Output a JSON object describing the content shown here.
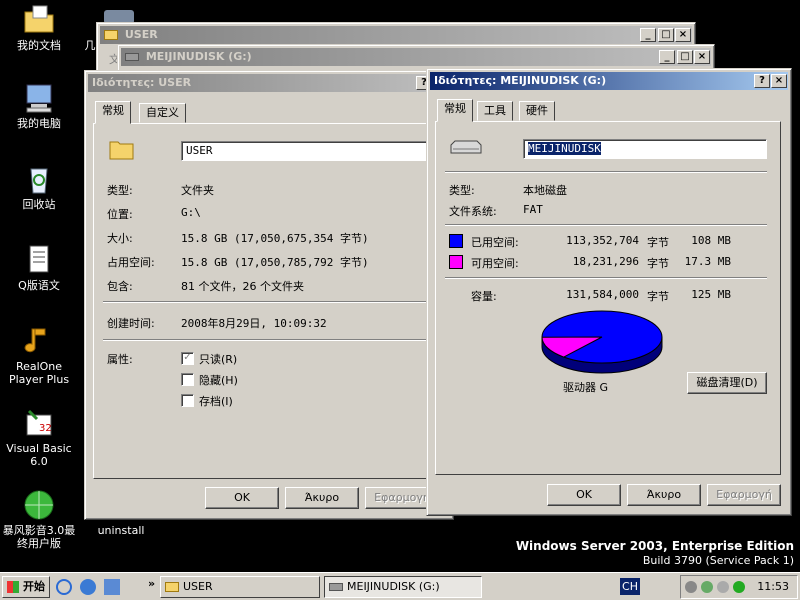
{
  "desktop": {
    "icons": [
      {
        "label": "我的文档"
      },
      {
        "label": "我的电脑"
      },
      {
        "label": "回收站"
      },
      {
        "label": "Q版语文"
      },
      {
        "label": "RealOne Player Plus"
      },
      {
        "label": "Visual Basic 6.0"
      },
      {
        "label": "暴风影音3.0最终用户版"
      },
      {
        "label": "uninstall"
      },
      {
        "label": "几"
      }
    ],
    "os_line1": "Windows Server 2003, Enterprise Edition",
    "os_line2": "Build 3790 (Service Pack 1)"
  },
  "bg_windows": {
    "user_title": "USER",
    "meiji_title": "MEIJINUDISK (G:)",
    "partial_text": "文"
  },
  "user_props": {
    "title": "Ιδιότητες: USER",
    "tabs": [
      "常规",
      "自定义"
    ],
    "name_value": "USER",
    "rows": [
      {
        "label": "类型:",
        "value": "文件夹"
      },
      {
        "label": "位置:",
        "value": "G:\\"
      },
      {
        "label": "大小:",
        "value": "15.8 GB (17,050,675,354 字节)"
      },
      {
        "label": "占用空间:",
        "value": "15.8 GB (17,050,785,792 字节)"
      },
      {
        "label": "包含:",
        "value": "81 个文件，26 个文件夹"
      }
    ],
    "created_label": "创建时间:",
    "created_value": "2008年8月29日, 10:09:32",
    "attr_label": "属性:",
    "attrs": [
      {
        "label": "只读(R)",
        "checked": true
      },
      {
        "label": "隐藏(H)",
        "checked": false
      },
      {
        "label": "存档(I)",
        "checked": false
      }
    ],
    "buttons": {
      "ok": "OK",
      "cancel": "Άκυρο",
      "apply": "Εφαρμογή"
    },
    "help": "?"
  },
  "disk_props": {
    "title": "Ιδιότητες: MEIJINUDISK (G:)",
    "tabs": [
      "常规",
      "工具",
      "硬件"
    ],
    "name_value": "MEIJINUDISK",
    "type_label": "类型:",
    "type_value": "本地磁盘",
    "fs_label": "文件系统:",
    "fs_value": "FAT",
    "used_label": "已用空间:",
    "used_bytes": "113,352,704",
    "used_unit": "字节",
    "used_size": "108 MB",
    "free_label": "可用空间:",
    "free_bytes": "18,231,296",
    "free_unit": "字节",
    "free_size": "17.3 MB",
    "cap_label": "容量:",
    "cap_bytes": "131,584,000",
    "cap_unit": "字节",
    "cap_size": "125 MB",
    "drive_label": "驱动器 G",
    "cleanup": "磁盘清理(D)",
    "buttons": {
      "ok": "OK",
      "cancel": "Άκυρο",
      "apply": "Εφαρμογή"
    },
    "help": "?",
    "used_color": "#0000ff",
    "free_color": "#ff00ff",
    "used_fraction": 0.8614
  },
  "taskbar": {
    "start": "开始",
    "item1": "USER",
    "item2": "MEIJINUDISK (G:)",
    "lang": "CH",
    "clock": "11:53",
    "chevron": "»"
  }
}
